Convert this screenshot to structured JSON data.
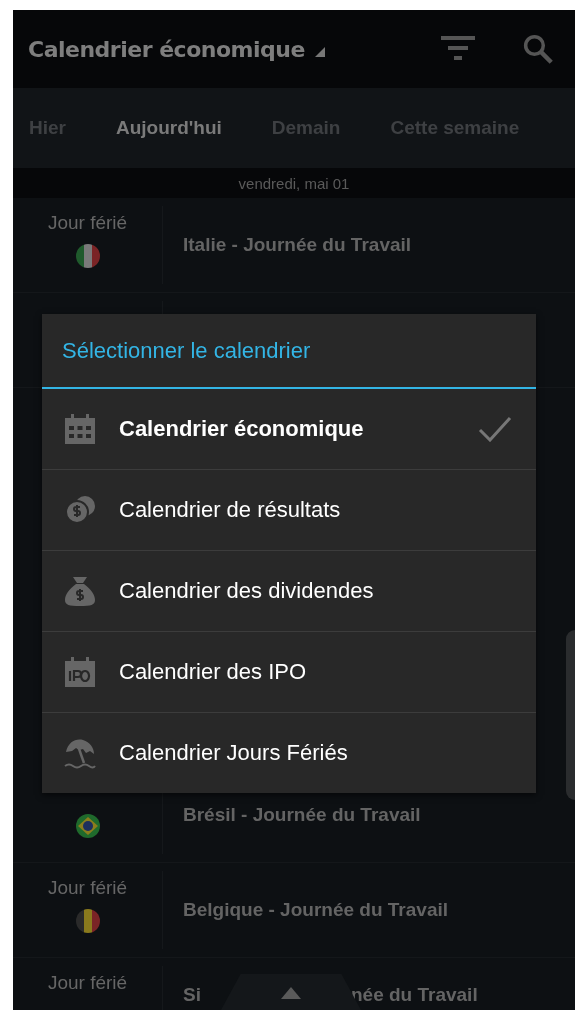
{
  "app_bar": {
    "title": "Calendrier économique"
  },
  "tabs": [
    {
      "label": "Hier",
      "selected": false
    },
    {
      "label": "Aujourd'hui",
      "selected": true
    },
    {
      "label": "Demain",
      "selected": false
    },
    {
      "label": "Cette semaine",
      "selected": false
    }
  ],
  "date_header": "vendredi, mai 01",
  "events": [
    {
      "kind": "full",
      "label": "Jour férié",
      "flag": {
        "kind": "it"
      },
      "title": "Italie - Journée du Travail"
    },
    {
      "kind": "covered"
    },
    {
      "kind": "full",
      "flag": {
        "kind": "br"
      },
      "title": "Brésil - Journée du Travail"
    },
    {
      "kind": "full",
      "label": "Jour férié",
      "flag": {
        "kind": "be"
      },
      "title": "Belgique - Journée du Travail"
    },
    {
      "kind": "split",
      "label": "Jour férié",
      "title_start": "Si",
      "title_end": "née du Travail"
    }
  ],
  "dialog": {
    "title": "Sélectionner le calendrier",
    "items": [
      {
        "kind": "calendar",
        "label": "Calendrier économique",
        "selected": true
      },
      {
        "kind": "coins",
        "label": "Calendrier de résultats",
        "selected": false
      },
      {
        "kind": "moneybag",
        "label": "Calendrier des dividendes",
        "selected": false
      },
      {
        "kind": "ipo",
        "label": "Calendrier des IPO",
        "selected": false
      },
      {
        "kind": "beach",
        "label": "Calendrier Jours Fériés",
        "selected": false
      }
    ]
  }
}
